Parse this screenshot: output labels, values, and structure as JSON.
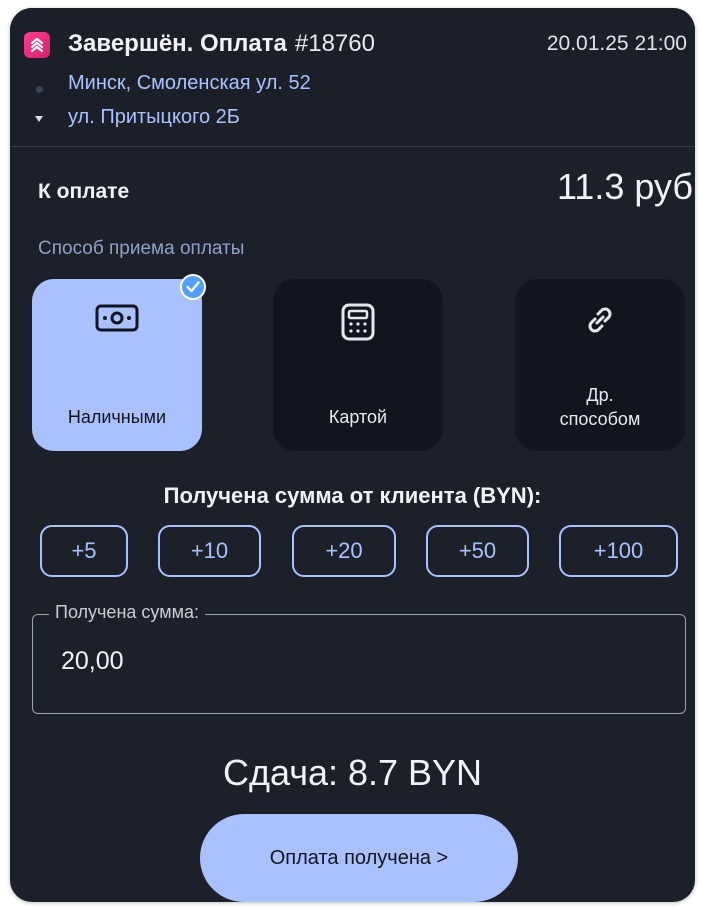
{
  "header": {
    "status_title": "Завершён. Оплата",
    "order_number": "#18760",
    "datetime": "20.01.25 21:00",
    "address_from": "Минск, Смоленская ул. 52",
    "address_to": "ул. Притыцкого 2Б",
    "logo_icon": "app-logo-icon"
  },
  "payment": {
    "label": "К оплате",
    "amount": "11.3 руб",
    "method_label": "Способ приема оплаты",
    "methods": [
      {
        "label": "Наличными",
        "icon": "cash-icon",
        "selected": true
      },
      {
        "label": "Картой",
        "icon": "card-terminal-icon",
        "selected": false
      },
      {
        "label_line1": "Др.",
        "label_line2": "способом",
        "icon": "link-icon",
        "selected": false
      }
    ]
  },
  "received": {
    "title": "Получена сумма от клиента (BYN):",
    "quick_amounts": [
      "+5",
      "+10",
      "+20",
      "+50",
      "+100"
    ],
    "field_label": "Получена сумма:",
    "field_value": "20,00"
  },
  "change_text": "Сдача: 8.7 BYN",
  "confirm_button": "Оплата получена >",
  "colors": {
    "background": "#1c2129",
    "accent": "#a9c2ff",
    "brand": "#e8287a",
    "check": "#4fa0ff"
  }
}
